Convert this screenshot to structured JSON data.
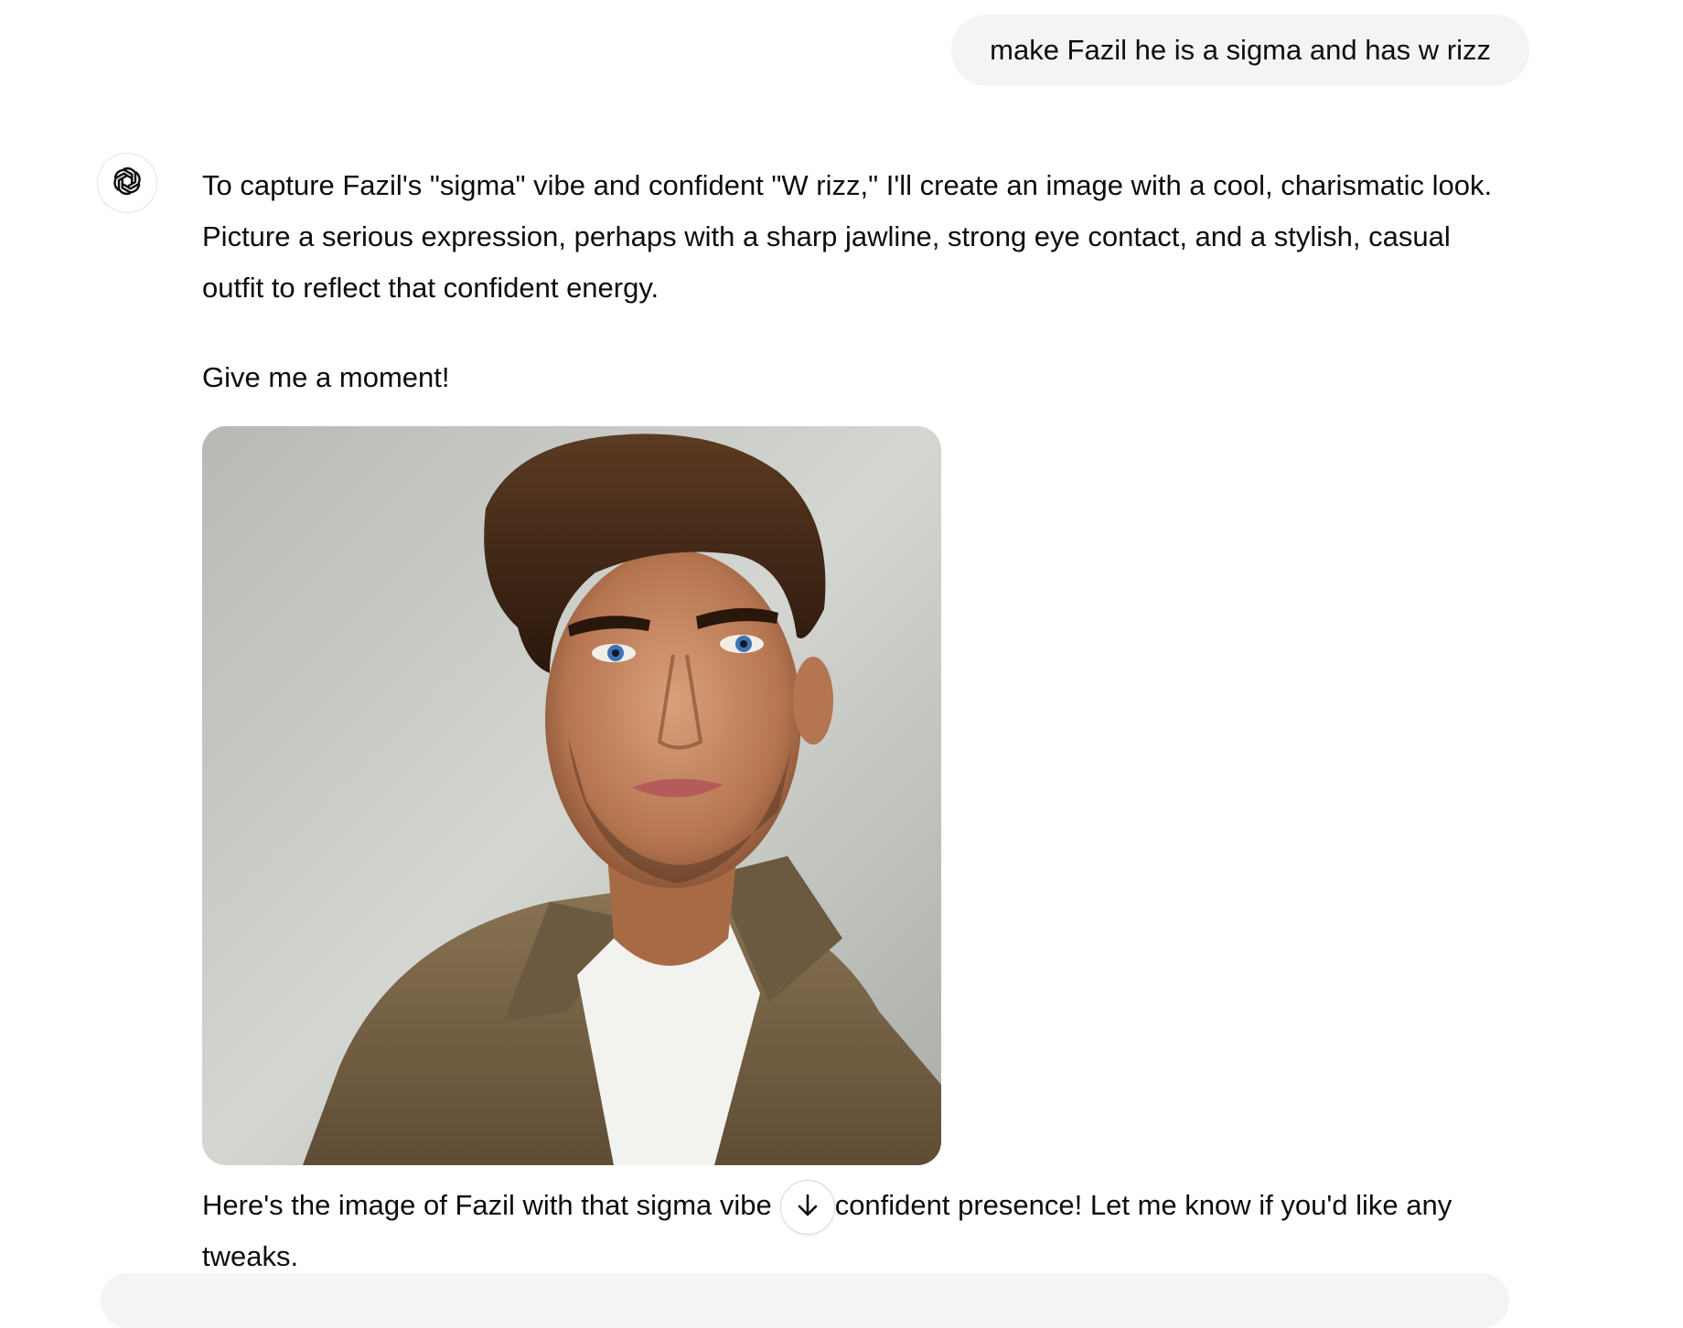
{
  "user_message": {
    "text": "make Fazil he is a sigma and has w rizz"
  },
  "assistant": {
    "avatar_icon": "openai-logo-icon",
    "paragraph_1": "To capture Fazil's \"sigma\" vibe and confident \"W rizz,\" I'll create an image with a cool, charismatic look. Picture a serious expression, perhaps with a sharp jawline, strong eye contact, and a stylish, casual outfit to reflect that confident energy.",
    "paragraph_2": "Give me a moment!",
    "paragraph_3": "Here's the image of Fazil with that sigma vibe and confident presence! Let me know if you'd like any tweaks."
  },
  "scroll_button": {
    "icon": "arrow-down-icon"
  },
  "colors": {
    "bubble_bg": "#f4f4f4",
    "text": "#0d0d0d",
    "border": "#e3e3e3"
  }
}
